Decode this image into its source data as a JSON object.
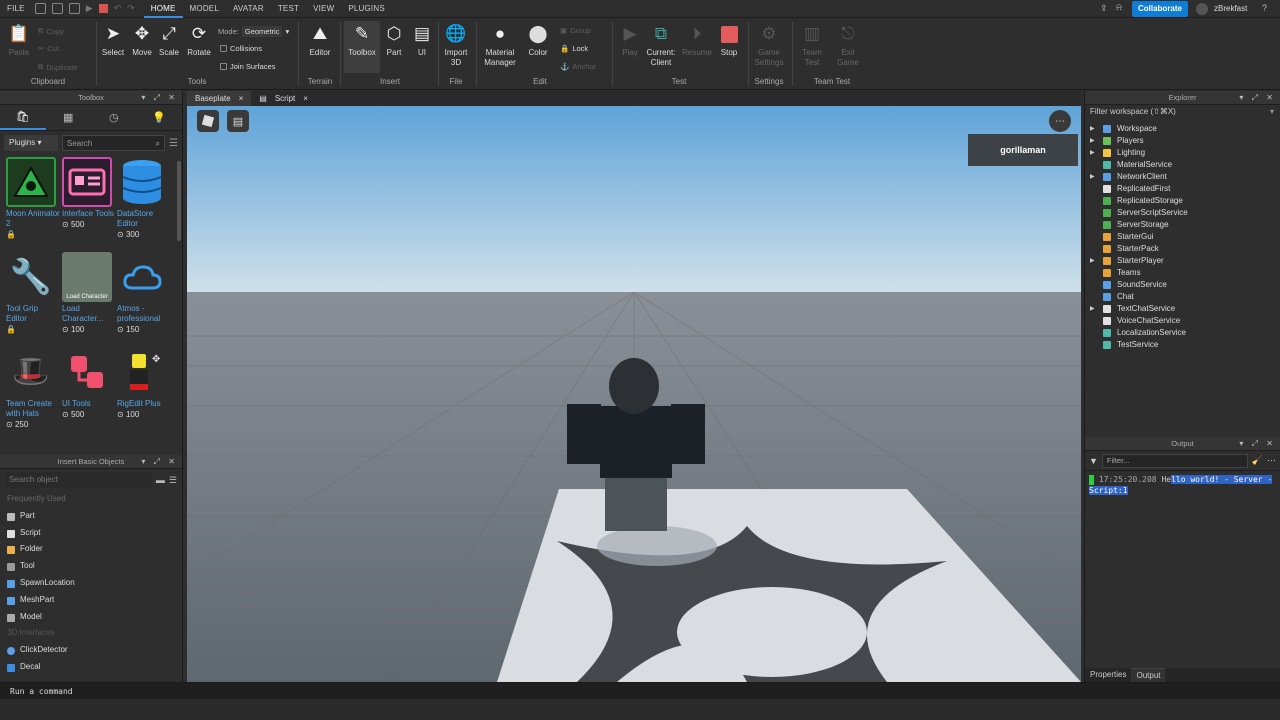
{
  "menubar": {
    "items": [
      "FILE",
      "HOME",
      "MODEL",
      "AVATAR",
      "TEST",
      "VIEW",
      "PLUGINS"
    ],
    "active": "HOME",
    "collab_label": "Collaborate",
    "user": "zBrekfast"
  },
  "ribbon": {
    "clipboard": {
      "paste": "Paste",
      "copy": "Copy",
      "cut": "Cut",
      "duplicate": "Duplicate",
      "group_label": "Clipboard"
    },
    "tools": {
      "select": "Select",
      "move": "Move",
      "scale": "Scale",
      "rotate": "Rotate",
      "mode_label": "Mode:",
      "mode_value": "Geometric",
      "collisions": "Collisions",
      "join_surfaces": "Join Surfaces",
      "group_label": "Tools"
    },
    "terrain": {
      "editor": "Editor",
      "group_label": "Terrain"
    },
    "insert": {
      "toolbox": "Toolbox",
      "part": "Part",
      "ui": "UI",
      "group_label": "Insert"
    },
    "file": {
      "import3d": "Import 3D",
      "group_label": "File"
    },
    "edit": {
      "material": "Material Manager",
      "color": "Color",
      "group": "Group",
      "lock": "Lock",
      "anchor": "Anchor",
      "group_label": "Edit"
    },
    "test": {
      "play": "Play",
      "current": "Current: Client",
      "resume": "Resume",
      "stop": "Stop",
      "group_label": "Test"
    },
    "settings": {
      "game": "Game Settings",
      "group_label": "Settings"
    },
    "teamtest": {
      "team": "Team Test",
      "exit": "Exit Game",
      "group_label": "Team Test"
    }
  },
  "toolbox": {
    "title": "Toolbox",
    "dropdown": "Plugins",
    "search_placeholder": "Search",
    "items": [
      {
        "name": "Moon Animator 2",
        "meta": ""
      },
      {
        "name": "Interface Tools",
        "meta": "500"
      },
      {
        "name": "DataStore Editor",
        "meta": "300"
      },
      {
        "name": "Tool Grip Editor",
        "meta": ""
      },
      {
        "name": "Load Character...",
        "meta": "100"
      },
      {
        "name": "Atmos - professional",
        "meta": "150"
      },
      {
        "name": "Team Create with Hats",
        "meta": "250"
      },
      {
        "name": "UI Tools",
        "meta": "500"
      },
      {
        "name": "RigEdit Plus",
        "meta": "100"
      }
    ],
    "load_char_caption": "Load Character"
  },
  "insert_objects": {
    "title": "Insert Basic Objects",
    "search_placeholder": "Search object",
    "frequently_used": "Frequently Used",
    "items": [
      "Part",
      "Script",
      "Folder",
      "Tool",
      "SpawnLocation",
      "MeshPart",
      "Model"
    ],
    "section2": "3D Interfaces",
    "items2": [
      "ClickDetector",
      "Decal"
    ]
  },
  "doctabs": [
    {
      "label": "Baseplate",
      "close": "×"
    },
    {
      "label": "Script",
      "close": "×"
    }
  ],
  "viewport": {
    "player_name": "gorillaman"
  },
  "explorer": {
    "title": "Explorer",
    "filter_placeholder": "Filter workspace (⇧⌘X)",
    "items": [
      {
        "label": "Workspace",
        "arrow": true,
        "color": "#5aa0e6"
      },
      {
        "label": "Players",
        "arrow": true,
        "color": "#6bc05a"
      },
      {
        "label": "Lighting",
        "arrow": true,
        "color": "#f2c744"
      },
      {
        "label": "MaterialService",
        "arrow": false,
        "color": "#4fb8a6"
      },
      {
        "label": "NetworkClient",
        "arrow": true,
        "color": "#5aa0e6"
      },
      {
        "label": "ReplicatedFirst",
        "arrow": false,
        "color": "#e0e0e0"
      },
      {
        "label": "ReplicatedStorage",
        "arrow": false,
        "color": "#4caf50"
      },
      {
        "label": "ServerScriptService",
        "arrow": false,
        "color": "#4caf50"
      },
      {
        "label": "ServerStorage",
        "arrow": false,
        "color": "#4caf50"
      },
      {
        "label": "StarterGui",
        "arrow": false,
        "color": "#e8a33a"
      },
      {
        "label": "StarterPack",
        "arrow": false,
        "color": "#e8a33a"
      },
      {
        "label": "StarterPlayer",
        "arrow": true,
        "color": "#e8a33a"
      },
      {
        "label": "Teams",
        "arrow": false,
        "color": "#e8a33a"
      },
      {
        "label": "SoundService",
        "arrow": false,
        "color": "#5aa0e6"
      },
      {
        "label": "Chat",
        "arrow": false,
        "color": "#5aa0e6"
      },
      {
        "label": "TextChatService",
        "arrow": true,
        "color": "#e0e0e0"
      },
      {
        "label": "VoiceChatService",
        "arrow": false,
        "color": "#e0e0e0"
      },
      {
        "label": "LocalizationService",
        "arrow": false,
        "color": "#4fb8a6"
      },
      {
        "label": "TestService",
        "arrow": false,
        "color": "#4fb8a6"
      }
    ]
  },
  "output": {
    "title": "Output",
    "filter_placeholder": "Filter...",
    "timestamp": "17:25:20.208",
    "message_pre": "He",
    "message_hl": "llo world!  - Server - Script:1",
    "tabs": [
      "Properties",
      "Output"
    ]
  },
  "command": {
    "placeholder": "Run a command"
  }
}
